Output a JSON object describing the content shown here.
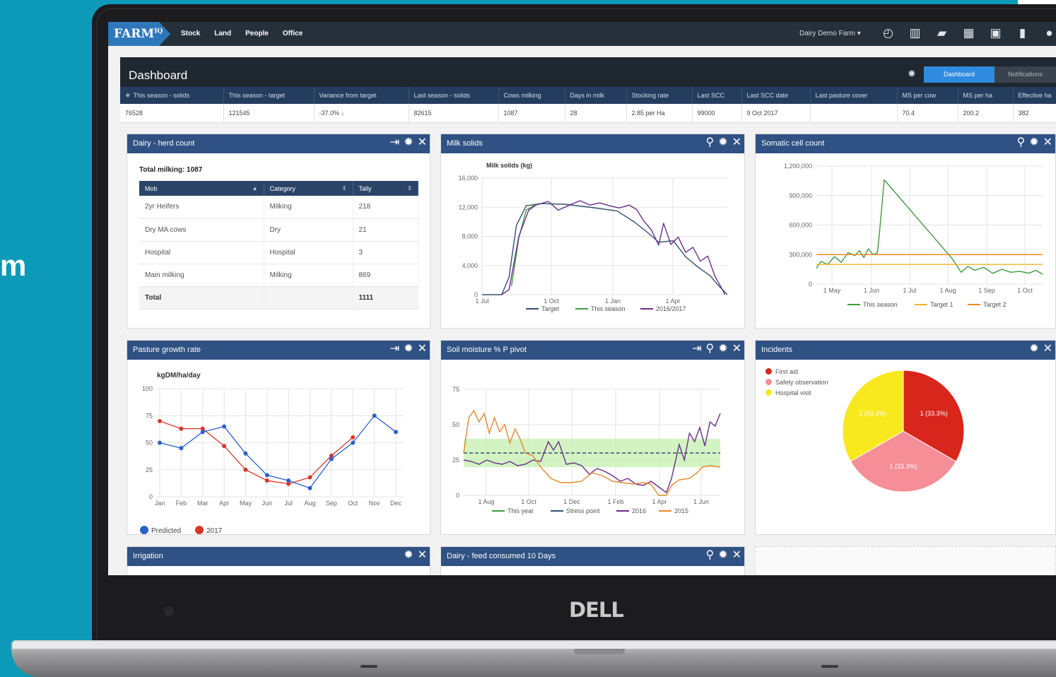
{
  "background_text": "m",
  "device_brand": "DELL",
  "nav": {
    "logo": "FARM",
    "logo_sup": "IQ",
    "links": [
      "Stock",
      "Land",
      "People",
      "Office"
    ],
    "farm_selector": "Dairy Demo Farm",
    "icons": [
      "speedometer-icon",
      "chart-icon",
      "folder-icon",
      "calendar-icon",
      "grid-icon",
      "map-icon",
      "help-icon"
    ]
  },
  "header": {
    "title": "Dashboard",
    "tab_active": "Dashboard",
    "tab_inactive": "Notifications"
  },
  "kpi": {
    "columns": [
      "This season - solids",
      "This season - target",
      "Variance from target",
      "Last season - solids",
      "Cows milking",
      "Days in milk",
      "Stocking rate",
      "Last SCC",
      "Last SCC date",
      "Last pasture cover",
      "MS per cow",
      "MS per ha",
      "Effective ha"
    ],
    "values": [
      "76528",
      "121545",
      "-37.0%",
      "82615",
      "1087",
      "28",
      "2.85 per Ha",
      "99000",
      "9 Oct 2017",
      "",
      "70.4",
      "200.2",
      "382"
    ]
  },
  "herd": {
    "title": "Dairy - herd count",
    "total_label": "Total milking: 1087",
    "headers": [
      "Mob",
      "Category",
      "Tally"
    ],
    "rows": [
      [
        "2yr Heifers",
        "Milking",
        "218"
      ],
      [
        "Dry MA cows",
        "Dry",
        "21"
      ],
      [
        "Hospital",
        "Hospital",
        "3"
      ],
      [
        "Main milking",
        "Milking",
        "869"
      ]
    ],
    "total": [
      "Total",
      "",
      "1111"
    ]
  },
  "panels": {
    "milk": "Milk solids",
    "scc": "Somatic cell count",
    "pasture": "Pasture growth rate",
    "soil": "Soil moisture % P pivot",
    "incidents": "Incidents",
    "irrigation": "Irrigation",
    "feed": "Dairy - feed consumed 10 Days"
  },
  "chart_data": [
    {
      "type": "line",
      "title": "Milk solids (kg)",
      "ylim": [
        0,
        16000
      ],
      "y_ticks": [
        "16,000",
        "12,000",
        "8,000",
        "4,000",
        "0"
      ],
      "x_ticks": [
        "1 Jul",
        "1 Oct",
        "1 Jan",
        "1 Apr"
      ],
      "series": [
        {
          "name": "Target",
          "color": "#34506e",
          "values": [
            [
              0,
              0
            ],
            [
              0.08,
              0
            ],
            [
              0.11,
              2400
            ],
            [
              0.14,
              9500
            ],
            [
              0.18,
              12200
            ],
            [
              0.24,
              12500
            ],
            [
              0.34,
              12400
            ],
            [
              0.44,
              12000
            ],
            [
              0.55,
              11500
            ],
            [
              0.62,
              10000
            ],
            [
              0.68,
              8400
            ],
            [
              0.72,
              7200
            ],
            [
              0.78,
              7400
            ],
            [
              0.83,
              5200
            ],
            [
              0.88,
              3800
            ],
            [
              0.93,
              2600
            ],
            [
              0.96,
              1400
            ],
            [
              1.0,
              0
            ]
          ]
        },
        {
          "name": "This season",
          "color": "#3f9a3f",
          "values": [
            [
              0.12,
              1200
            ],
            [
              0.15,
              7800
            ],
            [
              0.18,
              11600
            ],
            [
              0.21,
              12200
            ],
            [
              0.23,
              12500
            ]
          ]
        },
        {
          "name": "2016/2017",
          "color": "#6b2f8a",
          "values": [
            [
              0.08,
              0
            ],
            [
              0.11,
              700
            ],
            [
              0.15,
              8000
            ],
            [
              0.19,
              11600
            ],
            [
              0.22,
              12300
            ],
            [
              0.27,
              12800
            ],
            [
              0.31,
              11600
            ],
            [
              0.35,
              12200
            ],
            [
              0.4,
              12900
            ],
            [
              0.44,
              12300
            ],
            [
              0.48,
              12600
            ],
            [
              0.52,
              12200
            ],
            [
              0.56,
              11900
            ],
            [
              0.6,
              12300
            ],
            [
              0.63,
              11700
            ],
            [
              0.66,
              10100
            ],
            [
              0.69,
              8900
            ],
            [
              0.72,
              6800
            ],
            [
              0.74,
              9800
            ],
            [
              0.77,
              6900
            ],
            [
              0.8,
              7900
            ],
            [
              0.83,
              5800
            ],
            [
              0.86,
              6500
            ],
            [
              0.89,
              4600
            ],
            [
              0.92,
              5300
            ],
            [
              0.95,
              2500
            ],
            [
              0.98,
              700
            ],
            [
              0.99,
              0
            ]
          ]
        }
      ]
    },
    {
      "type": "line",
      "ylim": [
        0,
        1200000
      ],
      "y_ticks": [
        "1,200,000",
        "900,000",
        "600,000",
        "300,000",
        "0"
      ],
      "x_ticks": [
        "1 May",
        "1 Jun",
        "1 Jul",
        "1 Aug",
        "1 Sep",
        "1 Oct"
      ],
      "series": [
        {
          "name": "This season",
          "color": "#3f9a3f",
          "values": [
            [
              0,
              160000
            ],
            [
              0.02,
              230000
            ],
            [
              0.05,
              200000
            ],
            [
              0.08,
              280000
            ],
            [
              0.11,
              220000
            ],
            [
              0.14,
              320000
            ],
            [
              0.17,
              290000
            ],
            [
              0.19,
              340000
            ],
            [
              0.21,
              270000
            ],
            [
              0.23,
              360000
            ],
            [
              0.25,
              300000
            ],
            [
              0.27,
              320000
            ],
            [
              0.28,
              550000
            ],
            [
              0.3,
              1060000
            ],
            [
              0.6,
              260000
            ],
            [
              0.64,
              120000
            ],
            [
              0.67,
              180000
            ],
            [
              0.7,
              140000
            ],
            [
              0.74,
              170000
            ],
            [
              0.78,
              110000
            ],
            [
              0.82,
              150000
            ],
            [
              0.86,
              120000
            ],
            [
              0.9,
              130000
            ],
            [
              0.94,
              110000
            ],
            [
              0.97,
              140000
            ],
            [
              1.0,
              100000
            ]
          ]
        },
        {
          "name": "Target 1",
          "color": "#f0b323",
          "values": [
            [
              0,
              200000
            ],
            [
              1.0,
              200000
            ]
          ]
        },
        {
          "name": "Target 2",
          "color": "#f08a24",
          "values": [
            [
              0,
              300000
            ],
            [
              1.0,
              300000
            ]
          ]
        }
      ]
    },
    {
      "type": "line",
      "title": "kgDM/ha/day",
      "ylim": [
        0,
        100
      ],
      "y_ticks": [
        "100",
        "75",
        "50",
        "25",
        "0"
      ],
      "categories": [
        "Jan",
        "Feb",
        "Mar",
        "Apr",
        "May",
        "Jun",
        "Jul",
        "Aug",
        "Sep",
        "Oct",
        "Nov",
        "Dec"
      ],
      "series": [
        {
          "name": "Predicted",
          "color": "#2a62c9",
          "values": [
            50,
            45,
            60,
            65,
            40,
            20,
            15,
            8,
            35,
            50,
            75,
            60
          ]
        },
        {
          "name": "2017",
          "color": "#d9362a",
          "values": [
            70,
            63,
            63,
            47,
            25,
            15,
            12,
            18,
            38,
            55,
            null,
            null
          ]
        }
      ]
    },
    {
      "type": "line",
      "ylim": [
        0,
        75
      ],
      "y_ticks": [
        "75",
        "50",
        "25",
        "0"
      ],
      "x_ticks": [
        "1 Aug",
        "1 Oct",
        "1 Dec",
        "1 Feb",
        "1 Apr",
        "1 Jun"
      ],
      "series": [
        {
          "name": "This year",
          "color": "#3f9a3f",
          "values": []
        },
        {
          "name": "Stress point",
          "color": "#34506e",
          "values": [
            [
              0,
              30
            ],
            [
              1,
              30
            ]
          ]
        },
        {
          "name": "2016",
          "color": "#6b2f8a",
          "values": [
            [
              0,
              25
            ],
            [
              0.03,
              24
            ],
            [
              0.06,
              22
            ],
            [
              0.09,
              25
            ],
            [
              0.12,
              23
            ],
            [
              0.15,
              22
            ],
            [
              0.18,
              24
            ],
            [
              0.21,
              21
            ],
            [
              0.24,
              22
            ],
            [
              0.27,
              25
            ],
            [
              0.3,
              24
            ],
            [
              0.33,
              38
            ],
            [
              0.35,
              32
            ],
            [
              0.37,
              38
            ],
            [
              0.4,
              22
            ],
            [
              0.43,
              23
            ],
            [
              0.46,
              21
            ],
            [
              0.49,
              15
            ],
            [
              0.52,
              19
            ],
            [
              0.55,
              17
            ],
            [
              0.58,
              14
            ],
            [
              0.61,
              10
            ],
            [
              0.64,
              12
            ],
            [
              0.67,
              8
            ],
            [
              0.7,
              7
            ],
            [
              0.73,
              10
            ],
            [
              0.76,
              6
            ],
            [
              0.79,
              2
            ],
            [
              0.81,
              12
            ],
            [
              0.84,
              36
            ],
            [
              0.86,
              25
            ],
            [
              0.88,
              44
            ],
            [
              0.9,
              38
            ],
            [
              0.92,
              48
            ],
            [
              0.94,
              35
            ],
            [
              0.96,
              52
            ],
            [
              0.98,
              49
            ],
            [
              1.0,
              58
            ]
          ]
        },
        {
          "name": "2015",
          "color": "#e6872a",
          "values": [
            [
              0,
              30
            ],
            [
              0.02,
              55
            ],
            [
              0.04,
              60
            ],
            [
              0.06,
              52
            ],
            [
              0.08,
              58
            ],
            [
              0.1,
              44
            ],
            [
              0.12,
              55
            ],
            [
              0.14,
              45
            ],
            [
              0.16,
              50
            ],
            [
              0.18,
              37
            ],
            [
              0.2,
              47
            ],
            [
              0.22,
              40
            ],
            [
              0.24,
              30
            ],
            [
              0.27,
              28
            ],
            [
              0.3,
              20
            ],
            [
              0.34,
              12
            ],
            [
              0.38,
              9
            ],
            [
              0.42,
              9
            ],
            [
              0.46,
              10
            ],
            [
              0.5,
              16
            ],
            [
              0.54,
              14
            ],
            [
              0.58,
              10
            ],
            [
              0.62,
              9
            ],
            [
              0.66,
              8
            ],
            [
              0.7,
              9
            ],
            [
              0.73,
              8
            ],
            [
              0.76,
              0
            ],
            [
              0.79,
              0
            ],
            [
              0.81,
              7
            ],
            [
              0.84,
              11
            ],
            [
              0.88,
              12
            ],
            [
              0.91,
              16
            ],
            [
              0.93,
              20
            ],
            [
              0.96,
              21
            ],
            [
              1.0,
              20
            ]
          ]
        }
      ]
    },
    {
      "type": "pie",
      "legend": [
        "First aid",
        "Safety observation",
        "Hospital visit"
      ],
      "colors": [
        "#d8261c",
        "#f58e96",
        "#f7e91e"
      ],
      "values": [
        1,
        1,
        1
      ],
      "labels": [
        "1 (33.3%)",
        "1 (33.3%)",
        "1 (33.3%)"
      ]
    }
  ],
  "legends": {
    "milk": [
      "Target",
      "This season",
      "2016/2017"
    ],
    "scc": [
      "This season",
      "Target 1",
      "Target 2"
    ],
    "pasture": [
      "Predicted",
      "2017"
    ],
    "soil": [
      "This year",
      "Stress point",
      "2016",
      "2015"
    ]
  }
}
